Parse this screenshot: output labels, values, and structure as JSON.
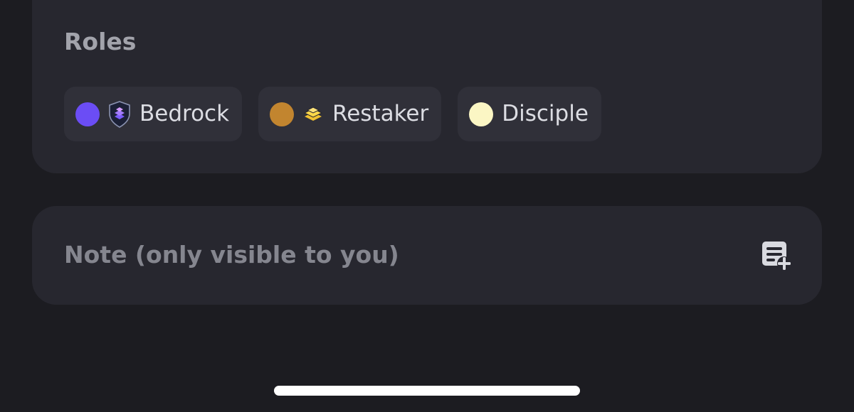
{
  "roles": {
    "title": "Roles",
    "items": [
      {
        "label": "Bedrock",
        "dot_color": "#6b4df5",
        "icon": "bedrock-shield-icon"
      },
      {
        "label": "Restaker",
        "dot_color": "#c2852f",
        "icon": "layers-icon"
      },
      {
        "label": "Disciple",
        "dot_color": "#fbf6c4",
        "icon": null
      }
    ]
  },
  "note": {
    "placeholder": "Note (only visible to you)",
    "action_icon": "note-add-icon"
  }
}
